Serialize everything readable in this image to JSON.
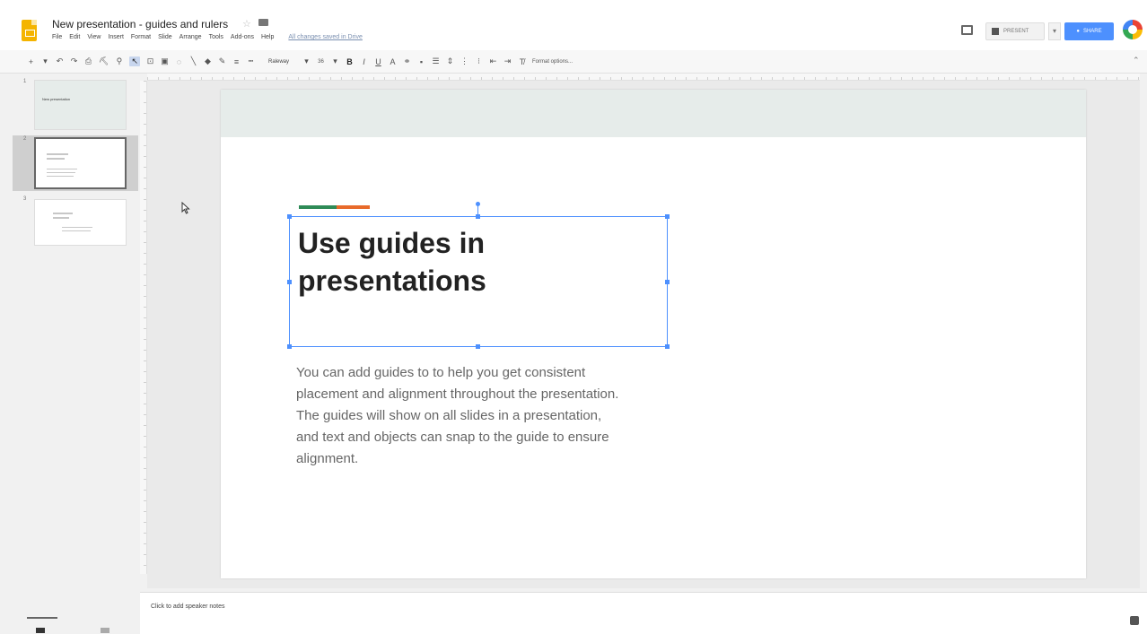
{
  "header": {
    "doc_title": "New presentation - guides and rulers",
    "menu": [
      "File",
      "Edit",
      "View",
      "Insert",
      "Format",
      "Slide",
      "Arrange",
      "Tools",
      "Add-ons",
      "Help"
    ],
    "saved_status": "All changes saved in Drive",
    "present_label": "PRESENT",
    "share_label": "SHARE"
  },
  "toolbar": {
    "font_name": "Raleway",
    "font_size": "36",
    "format_options": "Format options..."
  },
  "filmstrip": {
    "slides": [
      {
        "number": "1",
        "title": "New presentation"
      },
      {
        "number": "2",
        "title": "Use guides in presentations"
      },
      {
        "number": "3",
        "title": ""
      }
    ]
  },
  "slide": {
    "title": "Use guides in presentations",
    "body": "You can add guides to to help you get consistent placement and alignment throughout the presentation. The guides will show on all slides in a presentation, and text and objects can snap to the guide to ensure alignment.",
    "accent_colors": [
      "#2e8b57",
      "#e86a2a"
    ],
    "band_color": "#e6ecea"
  },
  "notes": {
    "placeholder": "Click to add speaker notes"
  },
  "colors": {
    "selection": "#4d90fe",
    "share": "#4d90fe",
    "logo": "#f4b400"
  }
}
